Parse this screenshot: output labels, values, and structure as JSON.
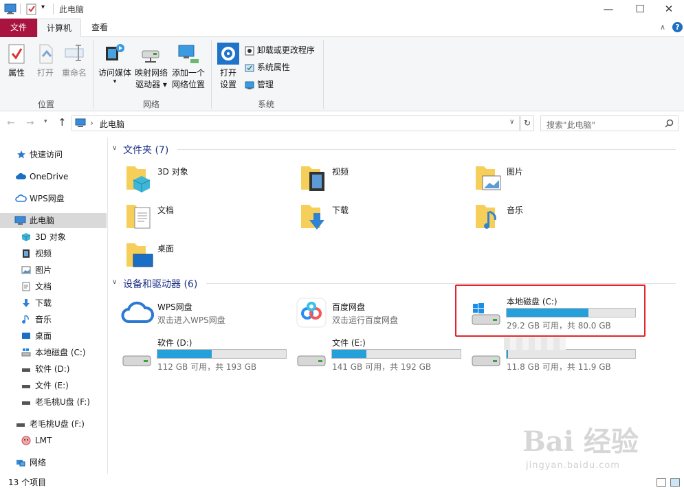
{
  "window": {
    "title": "此电脑",
    "minimize_icon": "—",
    "maximize_icon": "☐",
    "close_icon": "✕"
  },
  "ribbon": {
    "tabs": [
      {
        "label": "文件"
      },
      {
        "label": "计算机"
      },
      {
        "label": "查看"
      }
    ],
    "groups": {
      "location": {
        "label": "位置",
        "buttons": [
          {
            "label": "属性"
          },
          {
            "label": "打开"
          },
          {
            "label": "重命名"
          }
        ]
      },
      "network": {
        "label": "网络",
        "buttons": [
          {
            "label": "访问媒体"
          },
          {
            "label1": "映射网络",
            "label2": "驱动器"
          },
          {
            "label1": "添加一个",
            "label2": "网络位置"
          }
        ]
      },
      "system": {
        "label": "系统",
        "open_settings": {
          "label1": "打开",
          "label2": "设置"
        },
        "items": [
          {
            "label": "卸载或更改程序"
          },
          {
            "label": "系统属性"
          },
          {
            "label": "管理"
          }
        ]
      }
    }
  },
  "address": {
    "breadcrumb_sep": "›",
    "path": "此电脑",
    "search_placeholder": "搜索\"此电脑\""
  },
  "sidebar": {
    "items": [
      {
        "label": "快速访问"
      },
      {
        "label": "OneDrive"
      },
      {
        "label": "WPS网盘"
      },
      {
        "label": "此电脑"
      },
      {
        "label": "3D 对象"
      },
      {
        "label": "视频"
      },
      {
        "label": "图片"
      },
      {
        "label": "文档"
      },
      {
        "label": "下载"
      },
      {
        "label": "音乐"
      },
      {
        "label": "桌面"
      },
      {
        "label": "本地磁盘 (C:)"
      },
      {
        "label": "软件 (D:)"
      },
      {
        "label": "文件 (E:)"
      },
      {
        "label": "老毛桃U盘 (F:)"
      },
      {
        "label": "老毛桃U盘 (F:)"
      },
      {
        "label": "LMT"
      },
      {
        "label": "网络"
      }
    ]
  },
  "folders": {
    "heading": "文件夹 (7)",
    "items": [
      {
        "label": "3D 对象"
      },
      {
        "label": "视频"
      },
      {
        "label": "图片"
      },
      {
        "label": "文档"
      },
      {
        "label": "下载"
      },
      {
        "label": "音乐"
      },
      {
        "label": "桌面"
      }
    ]
  },
  "devices": {
    "heading": "设备和驱动器 (6)",
    "wps": {
      "title": "WPS网盘",
      "subtitle": "双击进入WPS网盘"
    },
    "baidu": {
      "title": "百度网盘",
      "subtitle": "双击运行百度网盘"
    },
    "drives": [
      {
        "title": "本地磁盘 (C:)",
        "info": "29.2 GB 可用，共 80.0 GB",
        "used_fraction": 0.635
      },
      {
        "title": "软件 (D:)",
        "info": "112 GB 可用，共 193 GB",
        "used_fraction": 0.42
      },
      {
        "title": "文件 (E:)",
        "info": "141 GB 可用，共 192 GB",
        "used_fraction": 0.27
      },
      {
        "title": "",
        "info": "11.8 GB 可用，共 11.9 GB",
        "used_fraction": 0.01
      }
    ]
  },
  "status": {
    "count": "13 个项目"
  },
  "colors": {
    "file_tab": "#a8133f",
    "accent_bar": "#26a0da",
    "highlight": "#e0262a",
    "section_head": "#1e3287"
  },
  "watermark": {
    "text": "Bai 经验",
    "url": "jingyan.baidu.com"
  }
}
